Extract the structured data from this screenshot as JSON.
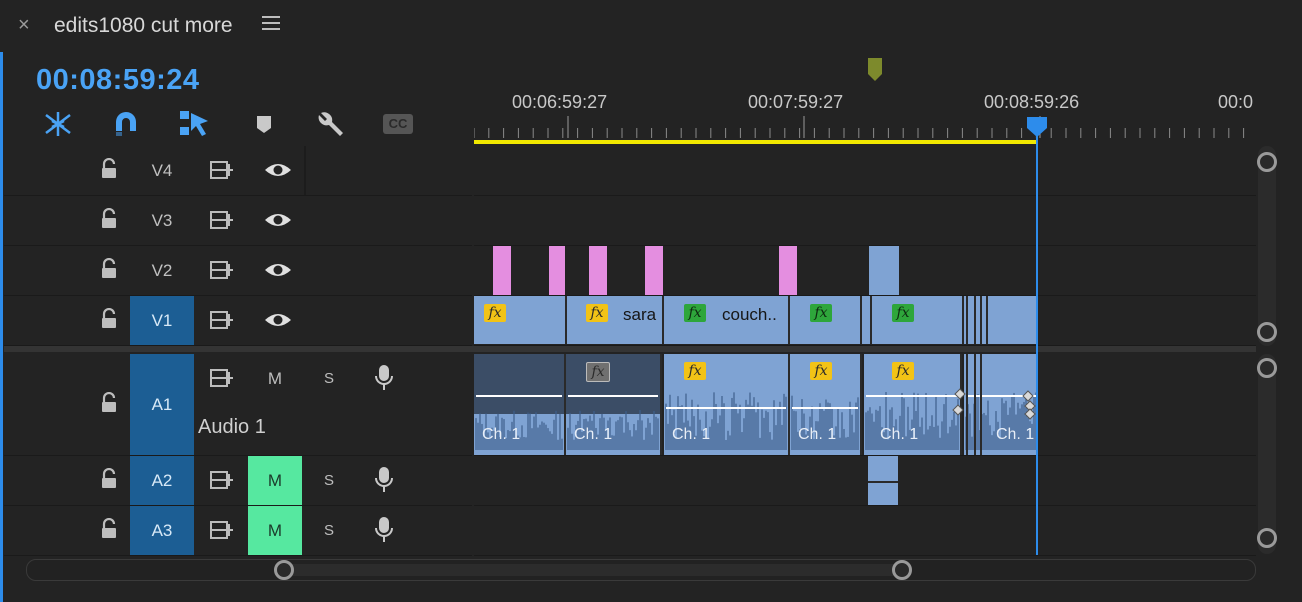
{
  "window": {
    "close_glyph": "×",
    "title": "edits1080 cut more"
  },
  "timecode": "00:08:59:24",
  "toolbar": {
    "icons": [
      "insert-overwrite-icon",
      "snap-magnet-icon",
      "linked-selection-icon",
      "add-marker-icon",
      "wrench-settings-icon",
      "closed-captions-icon"
    ],
    "cc_label": "CC"
  },
  "ruler": {
    "labels": [
      "00:06:59:27",
      "00:07:59:27",
      "00:08:59:26",
      "00:0"
    ]
  },
  "video_tracks": [
    {
      "name": "V4"
    },
    {
      "name": "V3"
    },
    {
      "name": "V2"
    },
    {
      "name": "V1"
    }
  ],
  "audio_tracks": [
    {
      "name": "A1",
      "title": "Audio 1",
      "mute": "M",
      "solo": "S",
      "muted": false
    },
    {
      "name": "A2",
      "mute": "M",
      "solo": "S",
      "muted": true
    },
    {
      "name": "A3",
      "mute": "M",
      "solo": "S",
      "muted": true
    }
  ],
  "clips": {
    "v1_names": [
      "sara",
      "couch.."
    ],
    "fx_label": "fx",
    "audio_channel_label": "Ch. 1"
  },
  "colors": {
    "accent_blue": "#2d8ceb",
    "timecode_blue": "#4aa3f5",
    "work_area_yellow": "#f1e800",
    "clip_blue": "#7fa3d3",
    "marker_pink": "#e48ee0",
    "mute_green": "#56e8a0",
    "target_blue": "#1c5e94"
  }
}
